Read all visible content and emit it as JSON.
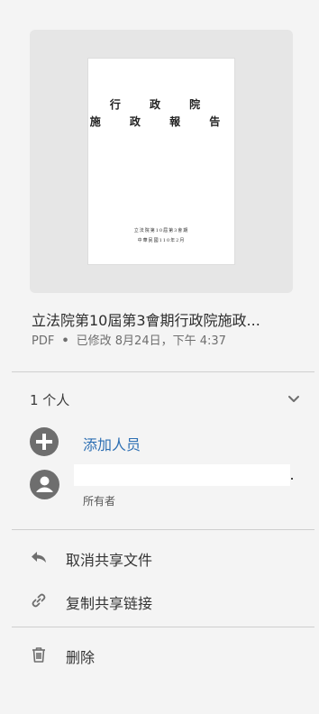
{
  "preview": {
    "doc_title_line1": "行 政 院",
    "doc_title_line2": "施 政 報 告",
    "doc_footer_line1": "立法院第10屆第3會期",
    "doc_footer_line2": "中華民國110年2月"
  },
  "file": {
    "name": "立法院第10屆第3會期行政院施政...",
    "type": "PDF",
    "modified": "已修改 8月24日，下午 4:37"
  },
  "sharing": {
    "people_count_label": "1 个人",
    "add_person_label": "添加人员",
    "owner_name": "",
    "owner_role": "所有者"
  },
  "actions": {
    "unshare_label": "取消共享文件",
    "copy_link_label": "复制共享链接",
    "delete_label": "删除"
  },
  "icons": {
    "expand": "chevron-down-icon",
    "add": "plus-circle-icon",
    "avatar": "person-icon",
    "unshare": "reply-arrow-icon",
    "link": "link-icon",
    "delete": "trash-icon"
  },
  "colors": {
    "accent_link": "#2d6fb3",
    "icon_gray": "#6e6e6e",
    "panel_bg": "#f4f4f4"
  }
}
